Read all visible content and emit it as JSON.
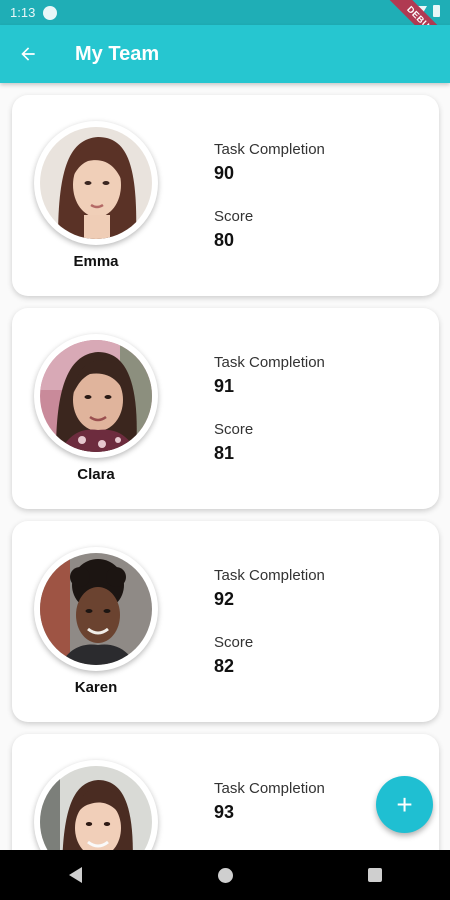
{
  "status_bar": {
    "time": "1:13",
    "debug_label": "DEBUG"
  },
  "app_bar": {
    "title": "My Team",
    "back_icon": "arrow-back-icon"
  },
  "members": [
    {
      "name": "Emma",
      "task_label": "Task Completion",
      "task_value": "90",
      "score_label": "Score",
      "score_value": "80"
    },
    {
      "name": "Clara",
      "task_label": "Task Completion",
      "task_value": "91",
      "score_label": "Score",
      "score_value": "81"
    },
    {
      "name": "Karen",
      "task_label": "Task Completion",
      "task_value": "92",
      "score_label": "Score",
      "score_value": "82"
    },
    {
      "name": "",
      "task_label": "Task Completion",
      "task_value": "93",
      "score_label": "",
      "score_value": ""
    }
  ],
  "fab": {
    "icon": "plus-icon",
    "label": "+"
  },
  "colors": {
    "primary": "#26c6d0",
    "status_bar": "#1faeb6",
    "fab": "#1fbfd2"
  }
}
